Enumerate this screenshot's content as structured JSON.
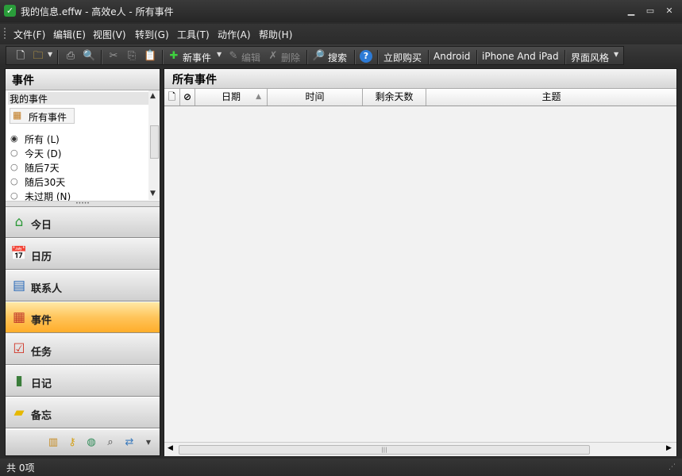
{
  "window": {
    "title": "我的信息.effw - 高效e人 - 所有事件",
    "minimize_glyph": "▁",
    "maximize_glyph": "▭",
    "close_glyph": "✕"
  },
  "menu": [
    {
      "label": "文件(F)"
    },
    {
      "label": "编辑(E)"
    },
    {
      "label": "视图(V)"
    },
    {
      "label": "转到(G)"
    },
    {
      "label": "工具(T)"
    },
    {
      "label": "动作(A)"
    },
    {
      "label": "帮助(H)"
    }
  ],
  "toolbar": {
    "new_event": "新事件",
    "edit": "编辑",
    "delete": "删除",
    "search": "搜索",
    "buy_now": "立即购买",
    "android": "Android",
    "iphone_ipad": "iPhone And iPad",
    "ui_style": "界面风格"
  },
  "left_pane": {
    "title": "事件",
    "section": "我的事件",
    "all_events": "所有事件",
    "filters": [
      {
        "label": "所有 (L)",
        "selected": true
      },
      {
        "label": "今天 (D)",
        "selected": false
      },
      {
        "label": "随后7天",
        "selected": false
      },
      {
        "label": "随后30天",
        "selected": false
      },
      {
        "label": "未过期 (N)",
        "selected": false
      }
    ],
    "nav": [
      {
        "label": "今日",
        "icon": "home-icon",
        "active": false
      },
      {
        "label": "日历",
        "icon": "calendar-icon",
        "active": false
      },
      {
        "label": "联系人",
        "icon": "contact-card-icon",
        "active": false
      },
      {
        "label": "事件",
        "icon": "event-icon",
        "active": true
      },
      {
        "label": "任务",
        "icon": "task-check-icon",
        "active": false
      },
      {
        "label": "日记",
        "icon": "diary-icon",
        "active": false
      },
      {
        "label": "备忘",
        "icon": "memo-icon",
        "active": false
      }
    ]
  },
  "right_pane": {
    "title": "所有事件",
    "columns": [
      "日期",
      "时间",
      "剩余天数",
      "主题"
    ]
  },
  "status": {
    "text": "共 0项"
  },
  "colors": {
    "chrome_dark": "#2b2b2b",
    "active_nav": "#ffc45a",
    "pane_bg": "#f2f2f2"
  }
}
